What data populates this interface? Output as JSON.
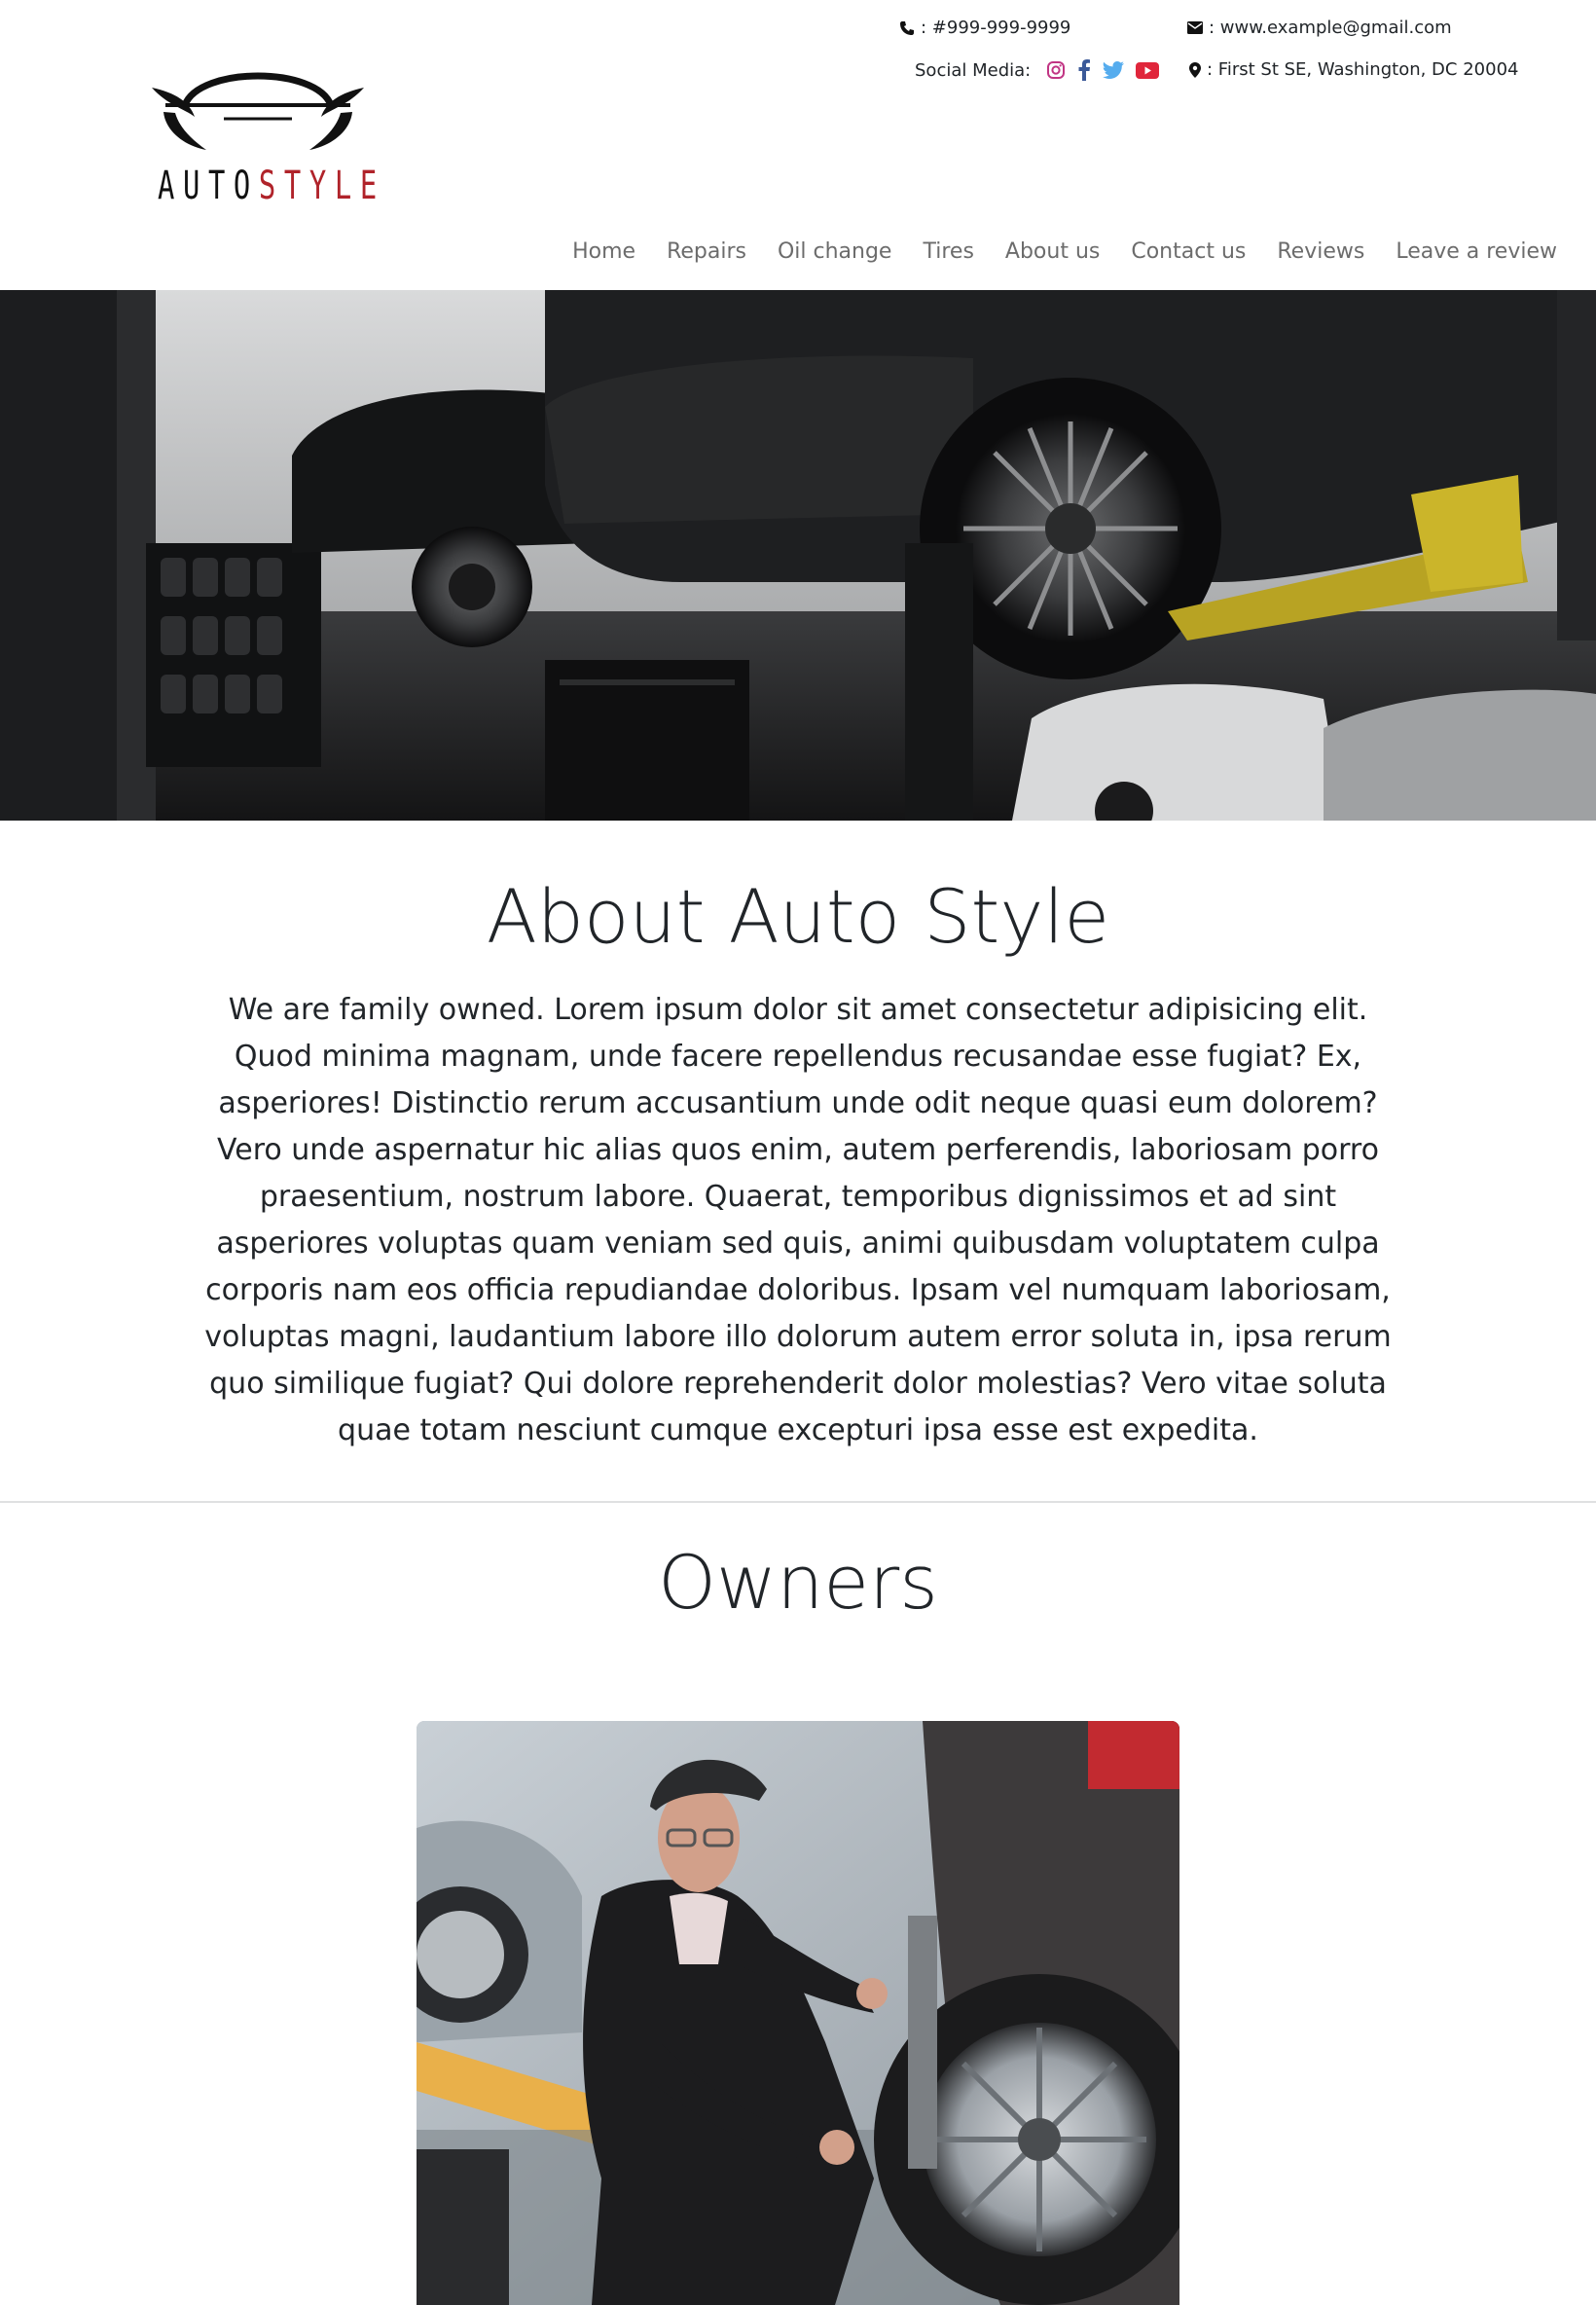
{
  "brand": {
    "logo_word_left": "AUTO",
    "logo_word_right": "STYLE",
    "accent_color": "#b0232a"
  },
  "header": {
    "phone": ": #999-999-9999",
    "email": ": www.example@gmail.com",
    "social_label": "Social Media:",
    "address": ": First St SE, Washington, DC 20004",
    "social_icons": [
      "instagram-icon",
      "facebook-icon",
      "twitter-icon",
      "youtube-icon"
    ]
  },
  "nav": {
    "items": [
      "Home",
      "Repairs",
      "Oil change",
      "Tires",
      "About us",
      "Contact us",
      "Reviews",
      "Leave a review"
    ]
  },
  "about": {
    "title": "About Auto Style",
    "body": "We are family owned. Lorem ipsum dolor sit amet consectetur adipisicing elit. Quod minima magnam, unde facere repellendus recusandae esse fugiat? Ex, asperiores! Distinctio rerum accusantium unde odit neque quasi eum dolorem? Vero unde aspernatur hic alias quos enim, autem perferendis, laboriosam porro praesentium, nostrum labore. Quaerat, temporibus dignissimos et ad sint asperiores voluptas quam veniam sed quis, animi quibusdam voluptatem culpa corporis nam eos officia repudiandae doloribus. Ipsam vel numquam laboriosam, voluptas magni, laudantium labore illo dolorum autem error soluta in, ipsa rerum quo similique fugiat? Qui dolore reprehenderit dolor molestias? Vero vitae soluta quae totam nesciunt cumque excepturi ipsa esse est expedita."
  },
  "owners": {
    "title": "Owners"
  }
}
